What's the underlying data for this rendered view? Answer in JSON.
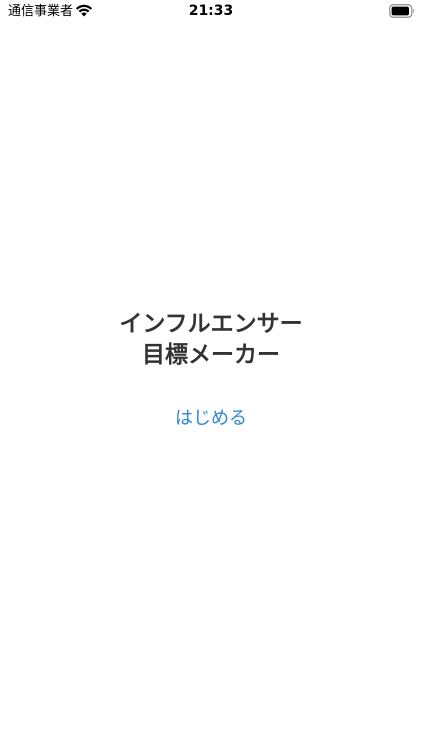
{
  "status_bar": {
    "carrier": "通信事業者",
    "time": "21:33",
    "wifi_icon": "wifi-icon",
    "battery_icon": "battery-icon",
    "battery_level": 0.95
  },
  "main": {
    "title_line1": "インフルエンサー",
    "title_line2": "目標メーカー",
    "start_label": "はじめる"
  },
  "colors": {
    "title": "#333333",
    "accent": "#2f86d6",
    "background": "#ffffff"
  }
}
